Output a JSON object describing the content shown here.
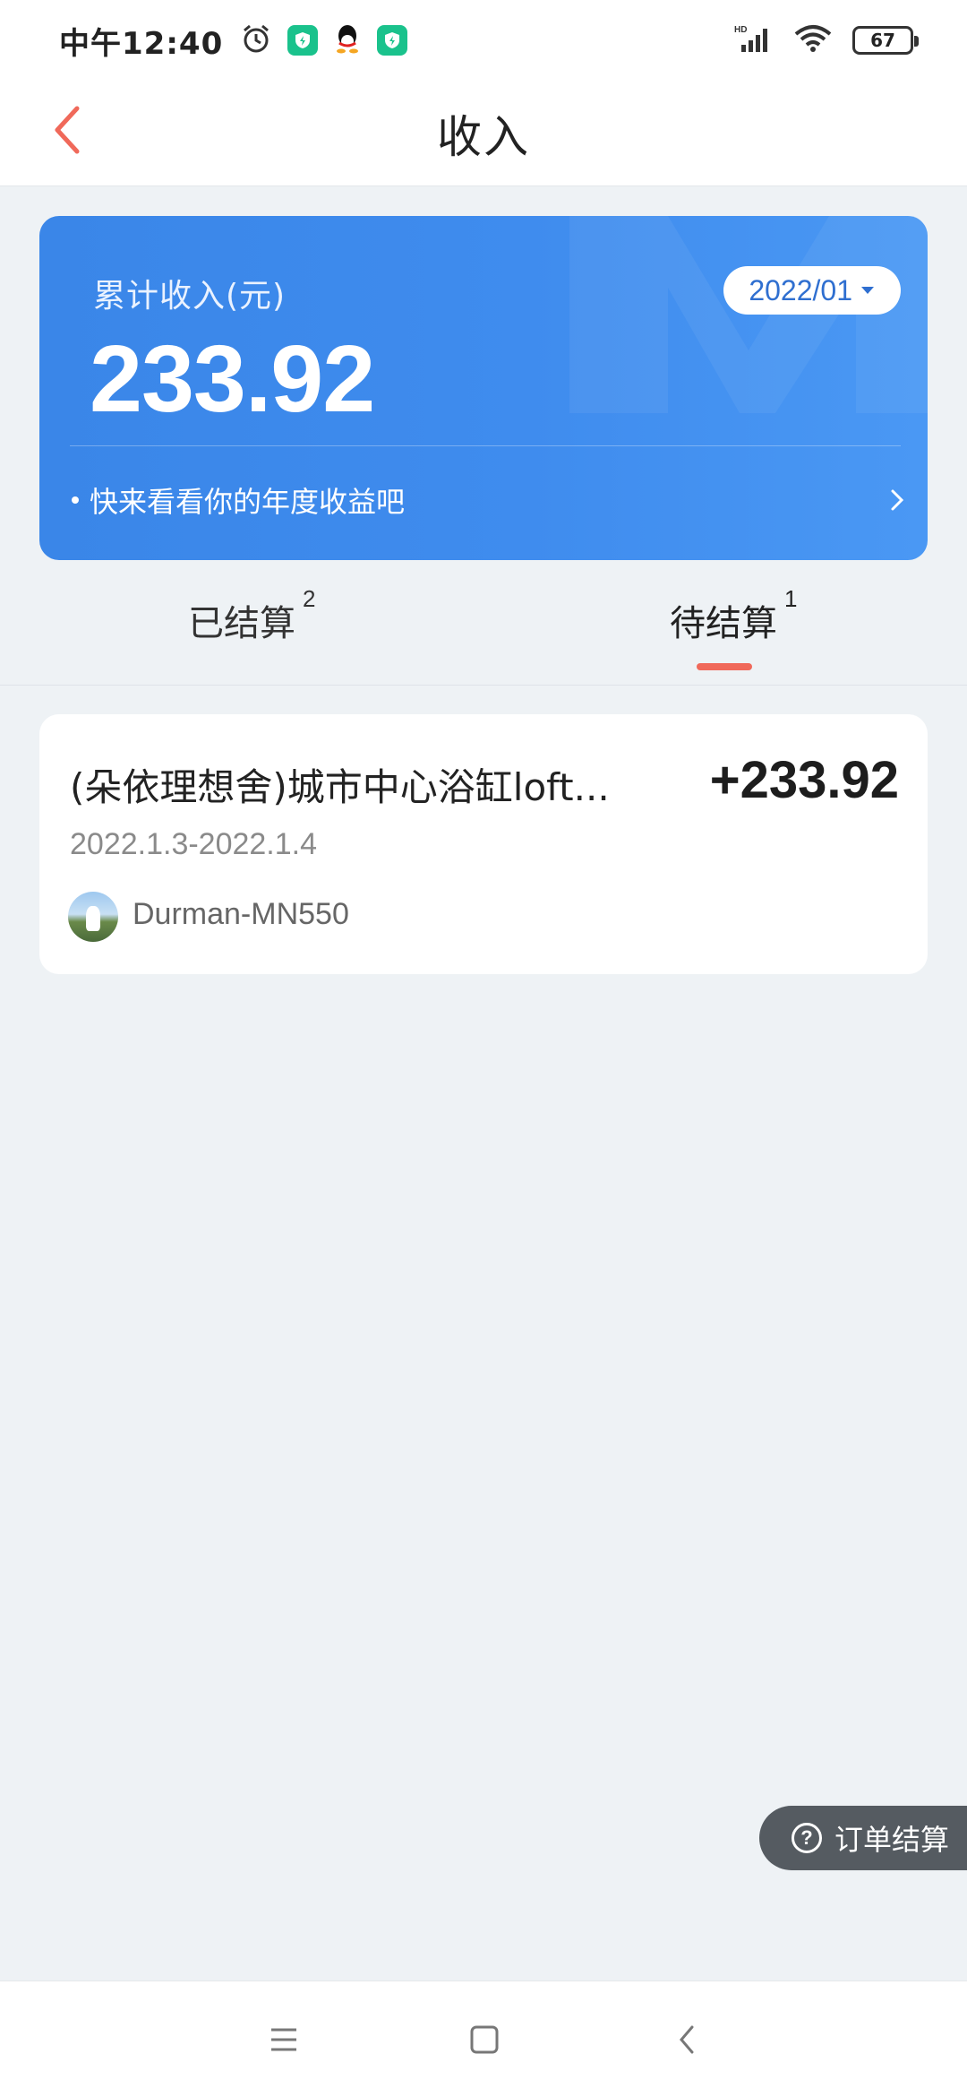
{
  "status_bar": {
    "time": "中午12:40",
    "battery": "67",
    "network_label": "HD",
    "icons": [
      "alarm-icon",
      "shield-app-icon",
      "qq-icon",
      "shield-app-icon",
      "signal-icon",
      "wifi-icon",
      "battery-icon"
    ]
  },
  "nav": {
    "title": "收入",
    "back_icon": "chevron-left-icon"
  },
  "summary": {
    "label": "累计收入(元)",
    "amount": "233.92",
    "month": "2022/01",
    "annual_link": "快来看看你的年度收益吧"
  },
  "tabs": [
    {
      "label": "已结算",
      "count": "2",
      "active": false
    },
    {
      "label": "待结算",
      "count": "1",
      "active": true
    }
  ],
  "orders": [
    {
      "title": "(朵依理想舍)城市中心浴缸loft...",
      "amount": "+233.92",
      "dates": "2022.1.3-2022.1.4",
      "host": "Durman-MN550"
    }
  ],
  "help_button": {
    "label": "订单结算",
    "icon": "question-circle-icon"
  },
  "colors": {
    "accent_blue": "#3a86e8",
    "accent_red": "#f0695a",
    "background": "#eef2f5"
  }
}
